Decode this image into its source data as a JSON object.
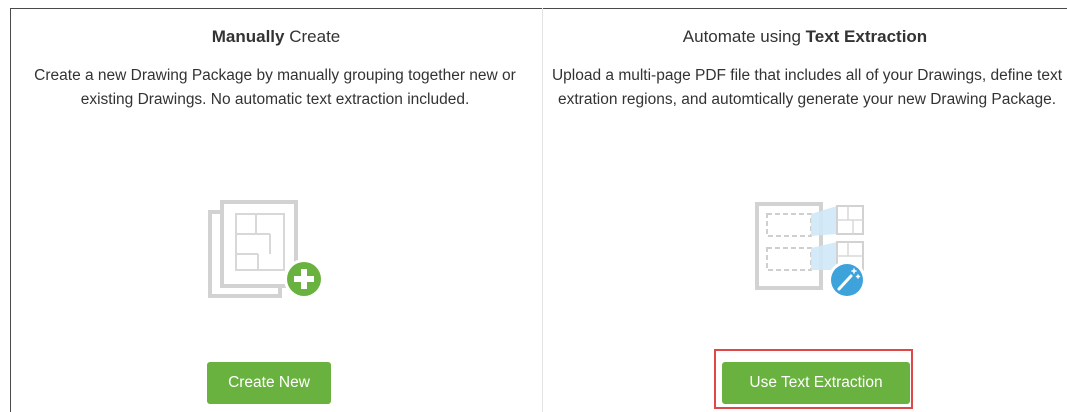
{
  "manual": {
    "title_strong": "Manually",
    "title_rest": " Create",
    "description": "Create a new Drawing Package by manually grouping together new or existing Drawings. No automatic text extraction included.",
    "icon": "drawing-stack-add-icon",
    "button_label": "Create New"
  },
  "automate": {
    "title_rest": "Automate using ",
    "title_strong": "Text Extraction",
    "description": "Upload a multi-page PDF file that includes all of your Drawings, define text extration regions, and automtically generate your new Drawing Package.",
    "icon": "text-extraction-wand-icon",
    "button_label": "Use Text Extraction"
  },
  "colors": {
    "button_green": "#6ab23f",
    "wand_blue": "#3ea2db",
    "highlight_red": "#e04848",
    "icon_gray": "#d2d2d2"
  }
}
